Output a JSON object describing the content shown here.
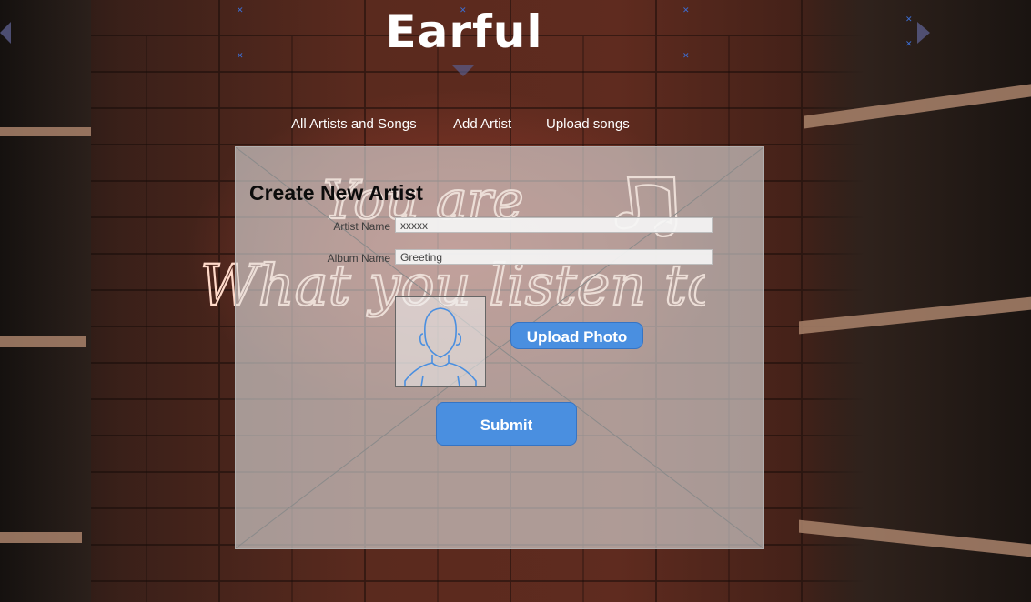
{
  "app": {
    "title": "Earful"
  },
  "nav": {
    "items": [
      {
        "label": "All Artists and Songs"
      },
      {
        "label": "Add Artist"
      },
      {
        "label": "Upload songs"
      }
    ]
  },
  "background": {
    "neon_line1": "You are",
    "neon_line2": "What you listen to"
  },
  "form": {
    "title": "Create New Artist",
    "artist_name": {
      "label": "Artist Name",
      "value": "xxxxx"
    },
    "album_name": {
      "label": "Album Name",
      "value": "Greeting"
    },
    "photo": {
      "icon": "user-avatar-icon"
    },
    "upload_label": "Upload Photo",
    "submit_label": "Submit"
  },
  "colors": {
    "accent": "#4a8fe0",
    "panel": "#e1e1e1",
    "logo": "#ffffff"
  }
}
